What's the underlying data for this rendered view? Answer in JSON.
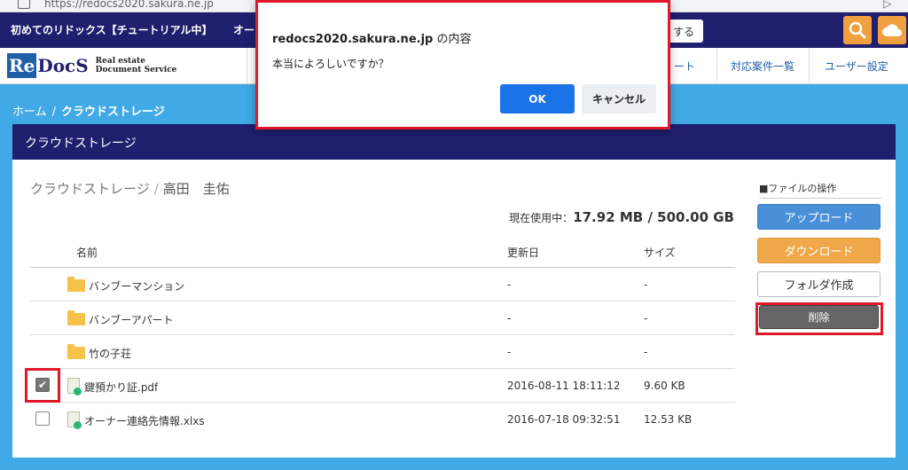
{
  "browser": {
    "url": "https://redocs2020.sakura.ne.jp"
  },
  "topbar": {
    "tutorial_label": "初めてのリドックス【チュートリアル中】",
    "truncated_label": "オー",
    "button_partial": "する"
  },
  "logo": {
    "main_re": "Re",
    "main_docs": "DocS",
    "sub_line1": "Real estate",
    "sub_line2": "Document Service"
  },
  "nav": {
    "items": [
      {
        "label": "ート"
      },
      {
        "label": "対応案件一覧"
      },
      {
        "label": "ユーザー設定"
      }
    ]
  },
  "breadcrumb": {
    "home": "ホーム",
    "separator": "/",
    "current": "クラウドストレージ"
  },
  "panel": {
    "title": "クラウドストレージ"
  },
  "path": {
    "root": "クラウドストレージ",
    "separator": "/",
    "user": "高田　圭佑"
  },
  "usage": {
    "label": "現在使用中：",
    "value": "17.92 MB / 500.00 GB"
  },
  "table": {
    "headers": {
      "name": "名前",
      "date": "更新日",
      "size": "サイズ"
    },
    "rows": [
      {
        "type": "folder",
        "name": "バンブーマンション",
        "date": "-",
        "size": "-"
      },
      {
        "type": "folder",
        "name": "バンブーアパート",
        "date": "-",
        "size": "-"
      },
      {
        "type": "folder",
        "name": "竹の子荘",
        "date": "-",
        "size": "-"
      },
      {
        "type": "file",
        "name": "鍵預かり証.pdf",
        "date": "2016-08-11 18:11:12",
        "size": "9.60 KB",
        "checked": true
      },
      {
        "type": "file",
        "name": "オーナー連絡先情報.xlxs",
        "date": "2016-07-18 09:32:51",
        "size": "12.53 KB",
        "checked": false
      }
    ]
  },
  "ops": {
    "title": "■ファイルの操作",
    "upload": "アップロード",
    "download": "ダウンロード",
    "new_folder": "フォルダ作成",
    "delete": "削除"
  },
  "dialog": {
    "origin": "redocs2020.sakura.ne.jp",
    "title_suffix": " の内容",
    "message": "本当によろしいですか？",
    "ok": "OK",
    "cancel": "キャンセル"
  },
  "colors": {
    "navy": "#1f1f6e",
    "sky": "#41a9e6",
    "accent_red": "#e0182a",
    "upload_blue": "#4a90d9",
    "download_orange": "#f0a94a"
  },
  "icons": [
    "info-icon",
    "search-icon",
    "cloud-icon",
    "folder-icon",
    "file-icon",
    "check-icon"
  ]
}
